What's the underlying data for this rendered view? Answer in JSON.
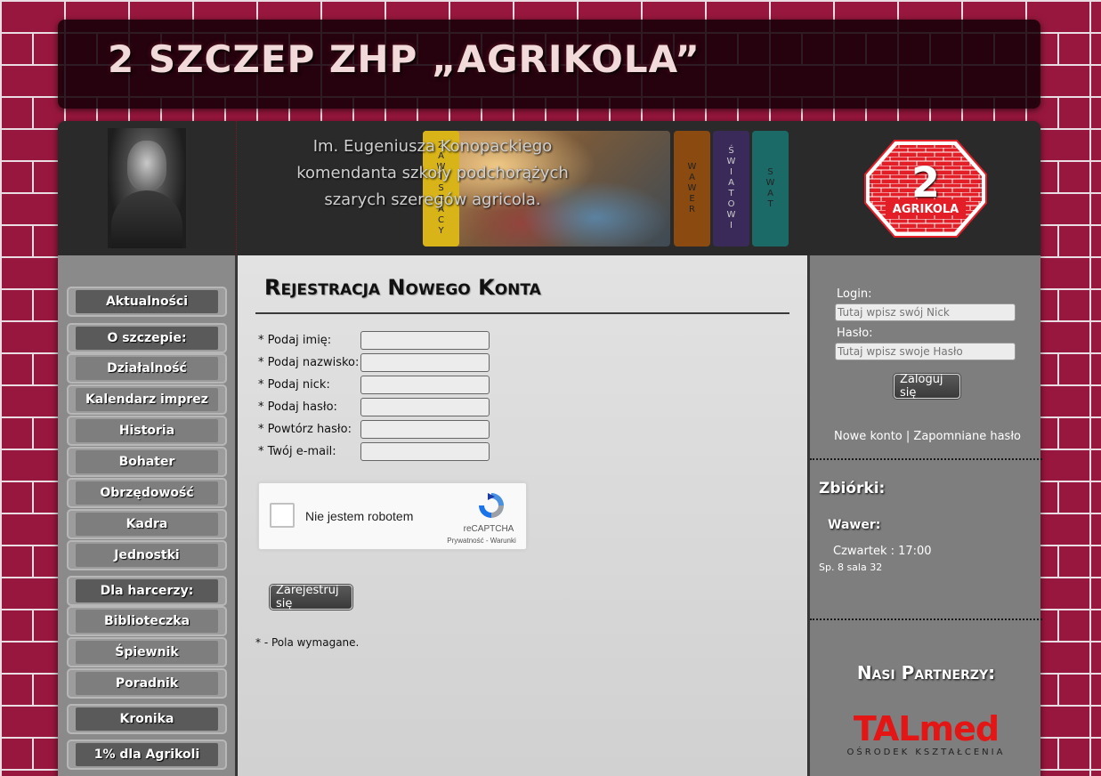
{
  "header": {
    "title": "2 SZCZEP ZHP „AGRIKOLA”"
  },
  "banner": {
    "dedication": [
      "Im. Eugeniusza Konopackiego",
      "komendanta szkoły podchorążych",
      "szarych szeregów agricola."
    ],
    "tabs": [
      "ZAWISZACY",
      "WAWER",
      "ŚWIATOWI",
      "SWAT"
    ],
    "logo_number": "2",
    "logo_name": "AGRIKOLA"
  },
  "nav": {
    "items": [
      "Aktualności",
      "O szczepie:",
      "Działalność",
      "Kalendarz imprez",
      "Historia",
      "Bohater",
      "Obrzędowość",
      "Kadra",
      "Jednostki",
      "Dla harcerzy:",
      "Biblioteczka",
      "Śpiewnik",
      "Poradnik",
      "Kronika",
      "1% dla Agrikoli"
    ]
  },
  "register": {
    "title": "Rejestracja Nowego Konta",
    "fields": [
      "* Podaj imię:",
      "* Podaj nazwisko:",
      "* Podaj nick:",
      "* Podaj hasło:",
      "* Powtórz hasło:",
      "* Twój e-mail:"
    ],
    "captcha_label": "Nie jestem robotem",
    "captcha_brand": "reCAPTCHA",
    "captcha_links": "Prywatność - Warunki",
    "submit": "Zarejestruj się",
    "required_note": "* - Pola wymagane."
  },
  "login": {
    "login_label": "Login:",
    "login_placeholder": "Tutaj wpisz swój Nick",
    "password_label": "Hasło:",
    "password_placeholder": "Tutaj wpisz swoje Hasło",
    "submit": "Zaloguj się",
    "new_account": "Nowe konto",
    "separator": "|",
    "forgot": "Zapomniane hasło"
  },
  "meetings": {
    "heading": "Zbiórki:",
    "unit": "Wawer:",
    "time": "Czwartek : 17:00",
    "place": "Sp. 8 sala 32"
  },
  "partners": {
    "heading": "Nasi Partnerzy:",
    "name": "TALmed",
    "subtitle": "OŚRODEK KSZTAŁCENIA"
  }
}
